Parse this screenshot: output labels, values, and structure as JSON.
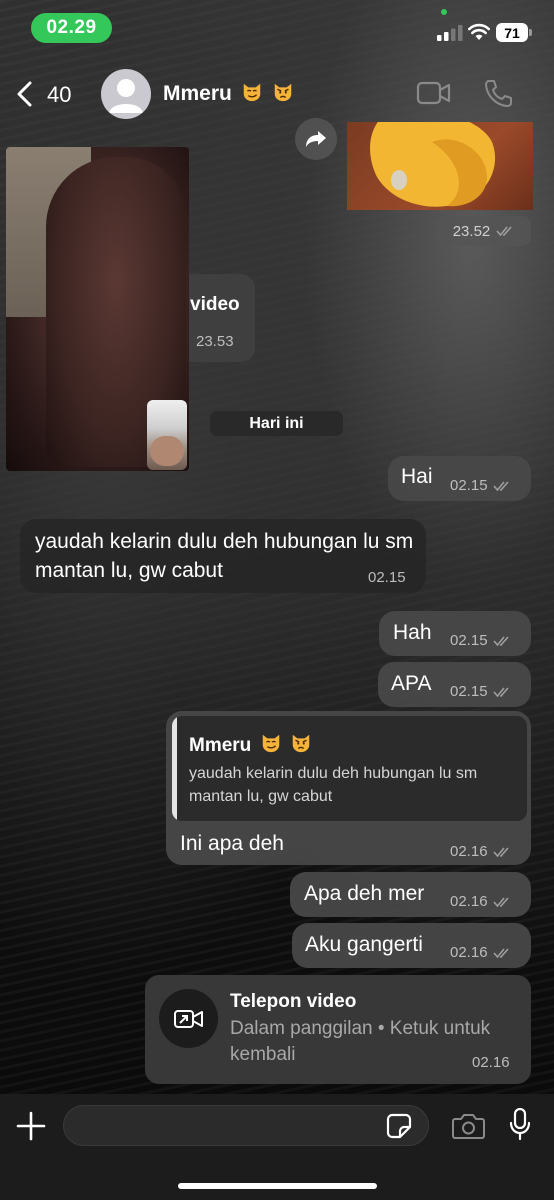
{
  "status_bar": {
    "time": "02.29",
    "battery": "71"
  },
  "header": {
    "back_count": "40",
    "contact_name": "Mmeru"
  },
  "media": {
    "top_time": "23.52",
    "video_label": "video",
    "video_time": "23.53"
  },
  "date_separator": "Hari ini",
  "messages": [
    {
      "text": "Hai",
      "time": "02.15",
      "direction": "out"
    },
    {
      "text": "yaudah kelarin dulu deh hubungan lu sm mantan lu, gw cabut",
      "time": "02.15",
      "direction": "in"
    },
    {
      "text": "Hah",
      "time": "02.15",
      "direction": "out"
    },
    {
      "text": "APA",
      "time": "02.15",
      "direction": "out"
    },
    {
      "text": "Ini apa deh",
      "time": "02.16",
      "direction": "out",
      "quote": {
        "author": "Mmeru",
        "text": "yaudah kelarin dulu deh hubungan lu sm mantan lu, gw cabut"
      }
    },
    {
      "text": "Apa deh mer",
      "time": "02.16",
      "direction": "out"
    },
    {
      "text": "Aku gangerti",
      "time": "02.16",
      "direction": "out"
    }
  ],
  "call_card": {
    "title": "Telepon video",
    "subtitle": "Dalam panggilan • Ketuk untuk kembali",
    "time": "02.16"
  },
  "composer": {
    "placeholder": "",
    "value": ""
  },
  "icons": {
    "back": "chevron-left-icon",
    "avatar": "person-icon",
    "video": "video-camera-icon",
    "phone": "phone-icon",
    "forward": "forward-arrow-icon",
    "plus": "plus-icon",
    "sticker": "sticker-icon",
    "camera": "camera-icon",
    "mic": "microphone-icon"
  },
  "colors": {
    "status_pill": "#34c759",
    "read_ticks": "#9e9e9e"
  }
}
